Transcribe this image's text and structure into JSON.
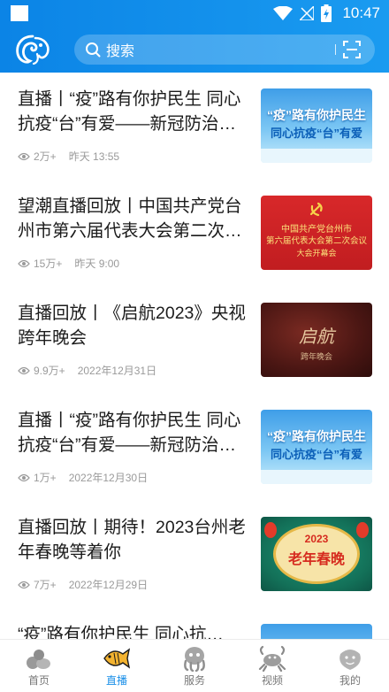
{
  "status_bar": {
    "time": "10:47"
  },
  "header": {
    "logo_icon": "app-logo-icon",
    "search": {
      "placeholder": "搜索",
      "icon": "search-icon",
      "scan_icon": "scan-icon"
    }
  },
  "colors": {
    "brand_blue": "#1a8fe8",
    "header_start": "#0b84e6",
    "header_end": "#1a9bf0"
  },
  "articles": [
    {
      "title": "直播丨“疫”路有你护民生 同心抗疫“台”有爱——新冠防治融…",
      "views": "2万+",
      "time": "昨天 13:55",
      "thumb": {
        "style": "blue",
        "line1": "“疫”路有你护民生",
        "line2": "同心抗疫“台”有爱"
      }
    },
    {
      "title": "望潮直播回放丨中国共产党台州市第六届代表大会第二次…",
      "views": "15万+",
      "time": "昨天 9:00",
      "thumb": {
        "style": "red",
        "line1": "中国共产党台州市",
        "line2": "第六届代表大会第二次会议",
        "line3": "大会开幕会"
      }
    },
    {
      "title": "直播回放丨《启航2023》央视跨年晚会",
      "views": "9.9万+",
      "time": "2022年12月31日",
      "thumb": {
        "style": "dark",
        "line1": "启航",
        "line2": "跨年晚会"
      }
    },
    {
      "title": "直播丨“疫”路有你护民生 同心抗疫“台”有爱——新冠防治融…",
      "views": "1万+",
      "time": "2022年12月30日",
      "thumb": {
        "style": "blue",
        "line1": "“疫”路有你护民生",
        "line2": "同心抗疫“台”有爱"
      }
    },
    {
      "title": "直播回放丨期待！2023台州老年春晚等着你",
      "views": "7万+",
      "time": "2022年12月29日",
      "thumb": {
        "style": "festive",
        "line1": "2023",
        "line2": "老年春晚"
      }
    },
    {
      "title": "“疫”路有你护民生 同心抗…",
      "views": "",
      "time": "",
      "thumb": {
        "style": "blue",
        "line1": "",
        "line2": ""
      }
    }
  ],
  "tabs": [
    {
      "label": "首页",
      "icon": "home-icon",
      "active": false
    },
    {
      "label": "直播",
      "icon": "live-fish-icon",
      "active": true
    },
    {
      "label": "服务",
      "icon": "service-octopus-icon",
      "active": false
    },
    {
      "label": "视频",
      "icon": "video-crab-icon",
      "active": false
    },
    {
      "label": "我的",
      "icon": "profile-shell-icon",
      "active": false
    }
  ]
}
